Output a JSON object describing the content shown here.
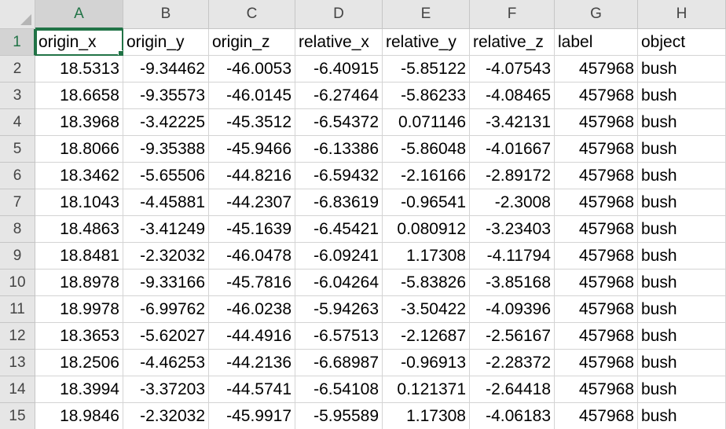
{
  "sheet": {
    "columns": [
      "A",
      "B",
      "C",
      "D",
      "E",
      "F",
      "G",
      "H"
    ],
    "selected_column": "A",
    "selected_row": "1",
    "rows": [
      {
        "num": "1",
        "cells": [
          "origin_x",
          "origin_y",
          "origin_z",
          "relative_x",
          "relative_y",
          "relative_z",
          "label",
          "object"
        ]
      },
      {
        "num": "2",
        "cells": [
          "18.5313",
          "-9.34462",
          "-46.0053",
          "-6.40915",
          "-5.85122",
          "-4.07543",
          "457968",
          "bush"
        ]
      },
      {
        "num": "3",
        "cells": [
          "18.6658",
          "-9.35573",
          "-46.0145",
          "-6.27464",
          "-5.86233",
          "-4.08465",
          "457968",
          "bush"
        ]
      },
      {
        "num": "4",
        "cells": [
          "18.3968",
          "-3.42225",
          "-45.3512",
          "-6.54372",
          "0.071146",
          "-3.42131",
          "457968",
          "bush"
        ]
      },
      {
        "num": "5",
        "cells": [
          "18.8066",
          "-9.35388",
          "-45.9466",
          "-6.13386",
          "-5.86048",
          "-4.01667",
          "457968",
          "bush"
        ]
      },
      {
        "num": "6",
        "cells": [
          "18.3462",
          "-5.65506",
          "-44.8216",
          "-6.59432",
          "-2.16166",
          "-2.89172",
          "457968",
          "bush"
        ]
      },
      {
        "num": "7",
        "cells": [
          "18.1043",
          "-4.45881",
          "-44.2307",
          "-6.83619",
          "-0.96541",
          "-2.3008",
          "457968",
          "bush"
        ]
      },
      {
        "num": "8",
        "cells": [
          "18.4863",
          "-3.41249",
          "-45.1639",
          "-6.45421",
          "0.080912",
          "-3.23403",
          "457968",
          "bush"
        ]
      },
      {
        "num": "9",
        "cells": [
          "18.8481",
          "-2.32032",
          "-46.0478",
          "-6.09241",
          "1.17308",
          "-4.11794",
          "457968",
          "bush"
        ]
      },
      {
        "num": "10",
        "cells": [
          "18.8978",
          "-9.33166",
          "-45.7816",
          "-6.04264",
          "-5.83826",
          "-3.85168",
          "457968",
          "bush"
        ]
      },
      {
        "num": "11",
        "cells": [
          "18.9978",
          "-6.99762",
          "-46.0238",
          "-5.94263",
          "-3.50422",
          "-4.09396",
          "457968",
          "bush"
        ]
      },
      {
        "num": "12",
        "cells": [
          "18.3653",
          "-5.62027",
          "-44.4916",
          "-6.57513",
          "-2.12687",
          "-2.56167",
          "457968",
          "bush"
        ]
      },
      {
        "num": "13",
        "cells": [
          "18.2506",
          "-4.46253",
          "-44.2136",
          "-6.68987",
          "-0.96913",
          "-2.28372",
          "457968",
          "bush"
        ]
      },
      {
        "num": "14",
        "cells": [
          "18.3994",
          "-3.37203",
          "-44.5741",
          "-6.54108",
          "0.121371",
          "-2.64418",
          "457968",
          "bush"
        ]
      },
      {
        "num": "15",
        "cells": [
          "18.9846",
          "-2.32032",
          "-45.9917",
          "-5.95589",
          "1.17308",
          "-4.06183",
          "457968",
          "bush"
        ]
      }
    ]
  },
  "colors": {
    "accent": "#217346",
    "header_bg": "#e6e6e6",
    "gridline": "#d4d4d4"
  }
}
